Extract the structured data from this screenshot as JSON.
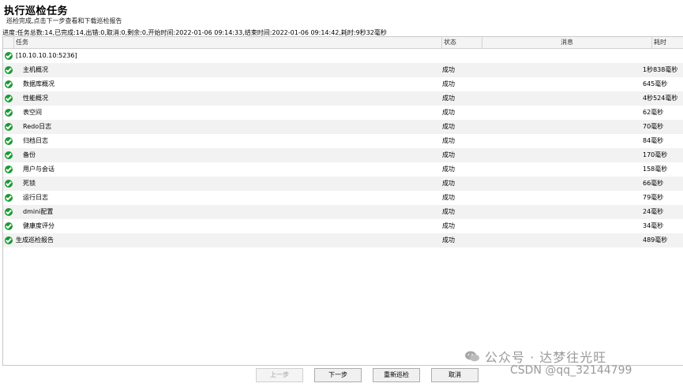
{
  "title": "执行巡检任务",
  "subtitle": "巡检完成,点击下一步查看和下载巡检报告",
  "progress": "进度:任务总数:14,已完成:14,出错:0,取消:0,剩余:0,开始时间:2022-01-06 09:14:33,结束时间:2022-01-06 09:14:42,耗时:9秒32毫秒",
  "columns": {
    "task": "任务",
    "status": "状态",
    "message": "消息",
    "time": "耗时"
  },
  "rows": [
    {
      "task": "[10.10.10.10:5236]",
      "status": "",
      "message": "",
      "time": "",
      "level": 0,
      "icon": "check-icon"
    },
    {
      "task": "主机概况",
      "status": "成功",
      "message": "",
      "time": "1秒838毫秒",
      "level": 1,
      "icon": "check-icon"
    },
    {
      "task": "数据库概况",
      "status": "成功",
      "message": "",
      "time": "645毫秒",
      "level": 1,
      "icon": "check-icon"
    },
    {
      "task": "性能概况",
      "status": "成功",
      "message": "",
      "time": "4秒524毫秒",
      "level": 1,
      "icon": "check-icon"
    },
    {
      "task": "表空间",
      "status": "成功",
      "message": "",
      "time": "62毫秒",
      "level": 1,
      "icon": "check-icon"
    },
    {
      "task": "Redo日志",
      "status": "成功",
      "message": "",
      "time": "70毫秒",
      "level": 1,
      "icon": "check-icon"
    },
    {
      "task": "归档日志",
      "status": "成功",
      "message": "",
      "time": "84毫秒",
      "level": 1,
      "icon": "check-icon"
    },
    {
      "task": "备份",
      "status": "成功",
      "message": "",
      "time": "170毫秒",
      "level": 1,
      "icon": "check-icon"
    },
    {
      "task": "用户与会话",
      "status": "成功",
      "message": "",
      "time": "158毫秒",
      "level": 1,
      "icon": "check-icon"
    },
    {
      "task": "死锁",
      "status": "成功",
      "message": "",
      "time": "66毫秒",
      "level": 1,
      "icon": "check-icon"
    },
    {
      "task": "运行日志",
      "status": "成功",
      "message": "",
      "time": "79毫秒",
      "level": 1,
      "icon": "check-icon"
    },
    {
      "task": "dmini配置",
      "status": "成功",
      "message": "",
      "time": "24毫秒",
      "level": 1,
      "icon": "check-icon"
    },
    {
      "task": "健康度评分",
      "status": "成功",
      "message": "",
      "time": "34毫秒",
      "level": 1,
      "icon": "check-icon"
    },
    {
      "task": "生成巡检报告",
      "status": "成功",
      "message": "",
      "time": "489毫秒",
      "level": 0,
      "icon": "check-icon"
    }
  ],
  "buttons": {
    "prev": "上一步",
    "next": "下一步",
    "rerun": "重新巡检",
    "cancel": "取消"
  },
  "watermark": {
    "top": "公众号 · 达梦往光旺",
    "bottom": "CSDN @qq_32144799"
  },
  "colors": {
    "success": "#1a9b34",
    "alt_row": "#f2f2f2"
  }
}
